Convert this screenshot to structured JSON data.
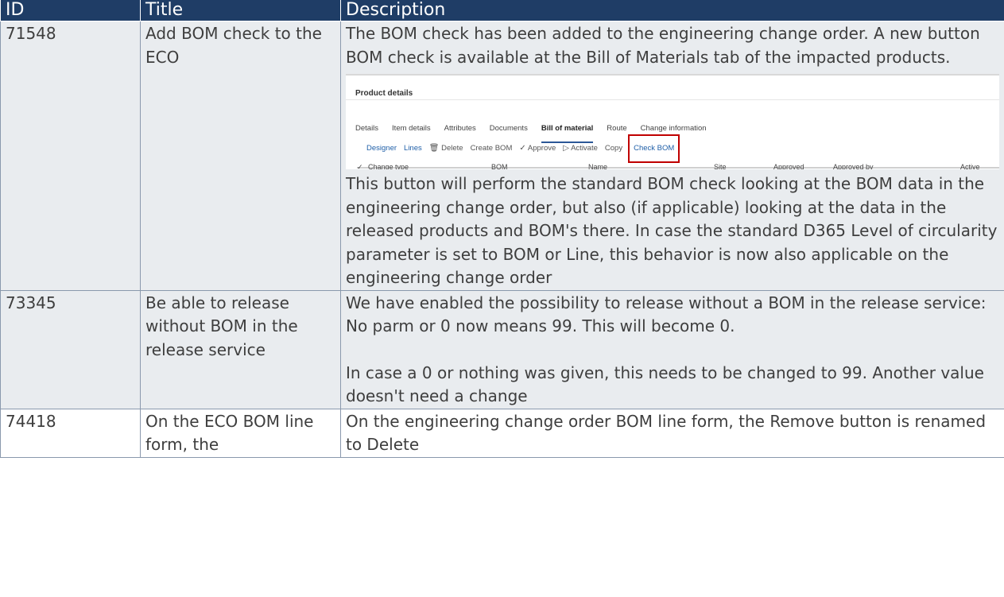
{
  "table": {
    "headers": [
      "ID",
      "Title",
      "Description"
    ],
    "rows": [
      {
        "id": "71548",
        "title": "Add BOM check to the ECO",
        "description_before": "The BOM check has been added to the engineering change order. A new button BOM check is available at the Bill of Materials tab of the impacted products.",
        "description_after": "This button will perform the standard BOM check looking at the BOM data in the engineering change order, but also (if applicable) looking at the data in the released products and BOM's there. In case the standard D365 Level of circularity parameter is set to BOM or Line, this behavior is now also applicable on the engineering change order"
      },
      {
        "id": "73345",
        "title": "Be able to release without BOM in the release service",
        "description_p1": "We have enabled the possibility to release without a BOM in the release service: No parm or 0 now means 99. This will become 0.",
        "description_p2": "In case a 0 or nothing was given, this needs to be changed to 99. Another value doesn't need a change"
      },
      {
        "id": "74418",
        "title": "On the ECO BOM line form, the",
        "description": "On the engineering change order BOM line form, the Remove button is renamed to Delete"
      }
    ]
  },
  "screenshot": {
    "heading": "Product details",
    "tabs": [
      "Details",
      "Item details",
      "Attributes",
      "Documents",
      "Bill of material",
      "Route",
      "Change information"
    ],
    "active_tab": "Bill of material",
    "actions": {
      "designer": "Designer",
      "lines": "Lines",
      "delete_icon": "trash-icon",
      "delete": "Delete",
      "create_bom": "Create BOM",
      "approve_icon": "check-icon",
      "approve": "Approve",
      "activate_icon": "play-icon",
      "activate": "Activate",
      "copy": "Copy",
      "check_bom": "Check BOM"
    },
    "grid_columns": [
      "Change type",
      "BOM",
      "Name",
      "Site",
      "Approved",
      "Approved by",
      "Active"
    ],
    "highlight_color": "#c00000"
  },
  "colors": {
    "header_bg": "#1f3d66",
    "shaded_row": "#e9ecef"
  }
}
